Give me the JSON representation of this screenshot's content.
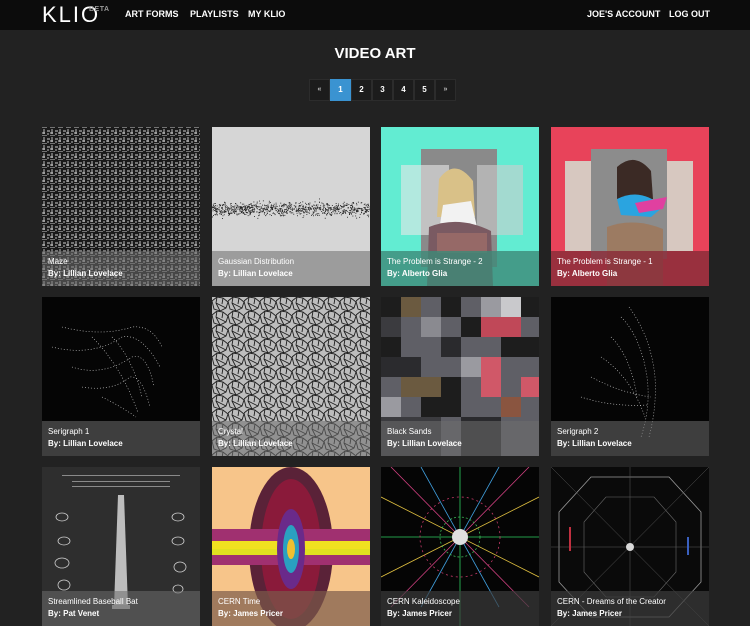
{
  "nav": {
    "logo": "KLIO",
    "beta": "BETA",
    "art_forms": "ART FORMS",
    "playlists": "PLAYLISTS",
    "my_klio": "MY KLIO",
    "account": "JOE'S ACCOUNT",
    "logout": "LOG OUT"
  },
  "page_title": "VIDEO ART",
  "pagination": {
    "prev": "«",
    "pages": [
      "1",
      "2",
      "3",
      "4",
      "5"
    ],
    "active": "1",
    "next": "»"
  },
  "by_prefix": "By:",
  "tiles": [
    {
      "title": "Maze",
      "author": "Lillian Lovelace",
      "caption_color": "#5c5c5c"
    },
    {
      "title": "Gaussian Distribution",
      "author": "Lillian Lovelace",
      "caption_color": "#5c5c5c"
    },
    {
      "title": "The Problem is Strange - 2",
      "author": "Alberto Glia",
      "caption_color": "#3d8a78"
    },
    {
      "title": "The Problem is Strange - 1",
      "author": "Alberto Glia",
      "caption_color": "#8b2d3a"
    },
    {
      "title": "Serigraph 1",
      "author": "Lillian Lovelace",
      "caption_color": "#5c5c5c"
    },
    {
      "title": "Crystal",
      "author": "Lillian Lovelace",
      "caption_color": "#5c5c5c"
    },
    {
      "title": "Black Sands",
      "author": "Lillian Lovelace",
      "caption_color": "#5c5c5c"
    },
    {
      "title": "Serigraph 2",
      "author": "Lillian Lovelace",
      "caption_color": "#5c5c5c"
    },
    {
      "title": "Streamlined Baseball Bat",
      "author": "Pat Venet",
      "caption_color": "#5c5c5c"
    },
    {
      "title": "CERN Time",
      "author": "James Pricer",
      "caption_color": "#7a5a4a"
    },
    {
      "title": "CERN Kaleidoscope",
      "author": "James Pricer",
      "caption_color": "#4a4a4a"
    },
    {
      "title": "CERN - Dreams of the Creator",
      "author": "James Pricer",
      "caption_color": "#4a4a4a"
    }
  ]
}
